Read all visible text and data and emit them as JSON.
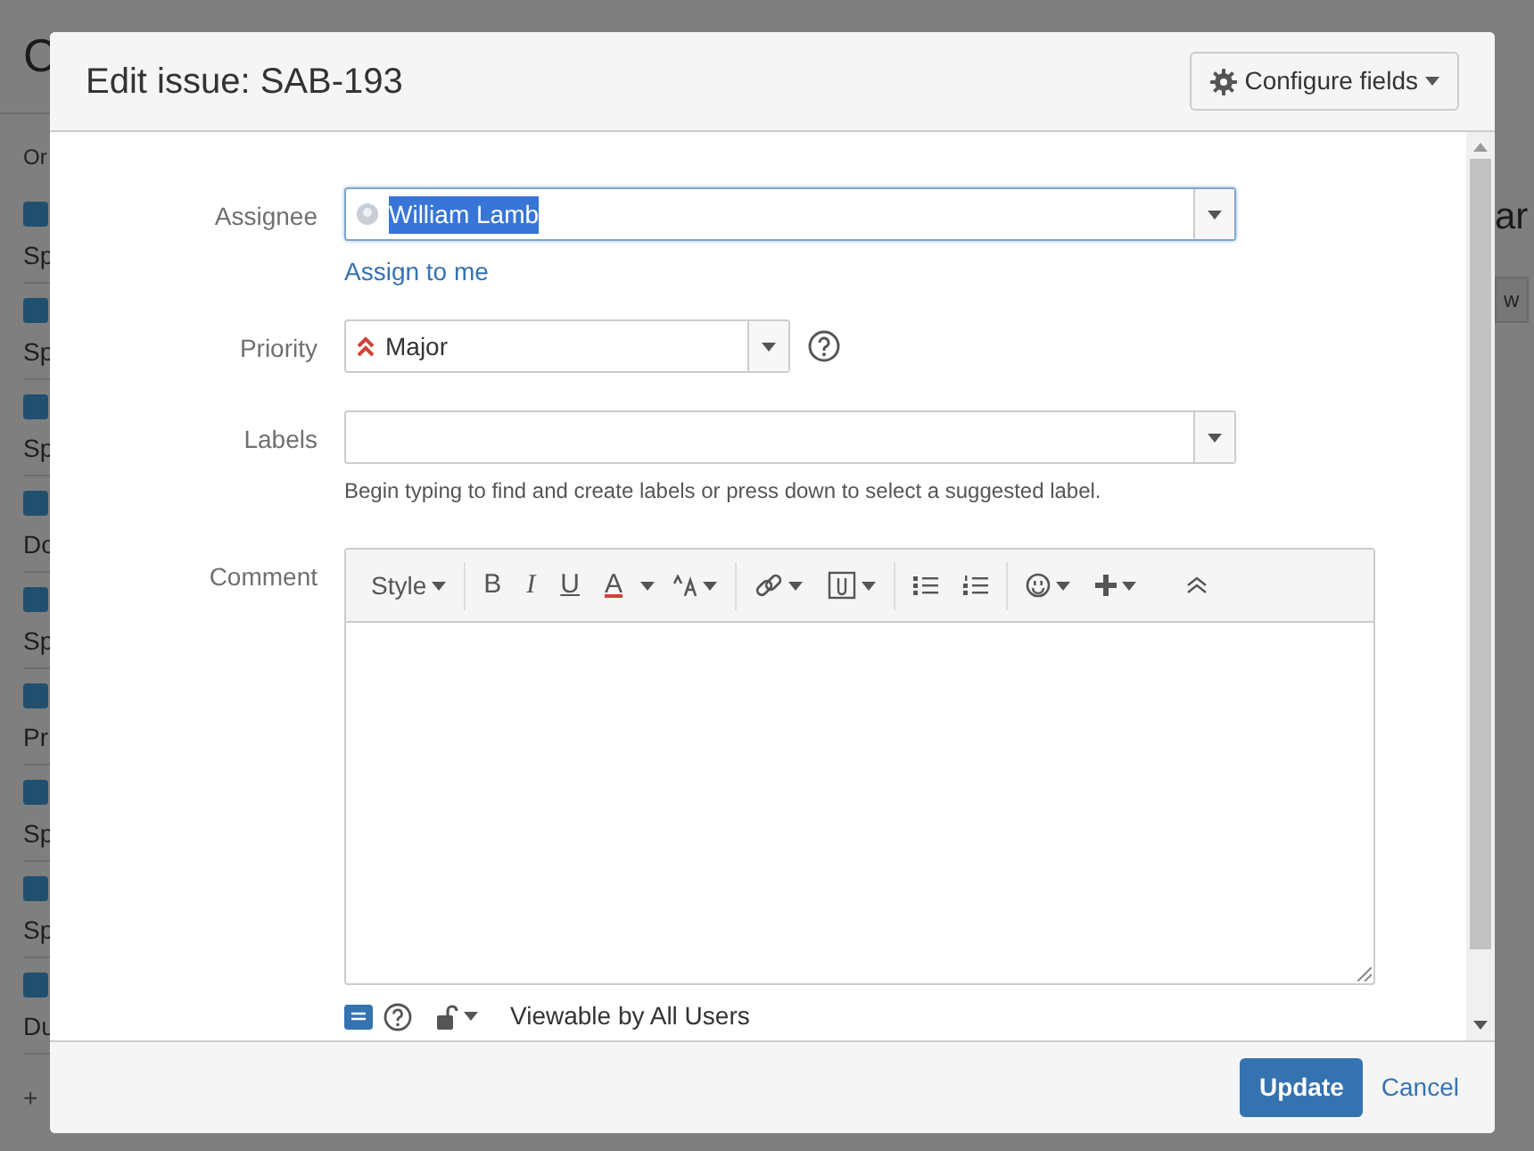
{
  "backdrop": {
    "page_title": "C",
    "sidebar_heading": "Or",
    "sidebar_items": [
      {
        "checked": true,
        "label": "Sp"
      },
      {
        "checked": true,
        "label": "Sp"
      },
      {
        "checked": true,
        "label": "Sp"
      },
      {
        "checked": true,
        "label": "Do"
      },
      {
        "checked": true,
        "label": "Sp"
      },
      {
        "checked": true,
        "label": "Pr"
      },
      {
        "checked": true,
        "label": "Sp"
      },
      {
        "checked": true,
        "label": "Sp"
      },
      {
        "checked": true,
        "label": "Du"
      }
    ],
    "add_label": "+",
    "right_title": "ar",
    "right_button": "w"
  },
  "dialog": {
    "title": "Edit issue: SAB-193",
    "configure_button": "Configure fields",
    "assignee": {
      "label": "Assignee",
      "value": "William Lamb",
      "highlighted": true,
      "focused": true,
      "link": "Assign to me"
    },
    "priority": {
      "label": "Priority",
      "value": "Major"
    },
    "labels": {
      "label": "Labels",
      "hint": "Begin typing to find and create labels or press down to select a suggested label."
    },
    "comment": {
      "label": "Comment",
      "toolbar": [
        {
          "kind": "dropdown",
          "label": "Style"
        },
        {
          "kind": "bold",
          "label": "B"
        },
        {
          "kind": "italic",
          "label": "I"
        },
        {
          "kind": "underline",
          "label": "U"
        },
        {
          "kind": "color",
          "label": "A"
        }
      ],
      "visibility": "Viewable by All Users"
    },
    "buttons": [
      {
        "kind": "primary",
        "label": "Update"
      },
      {
        "kind": "link",
        "label": "Cancel"
      }
    ]
  }
}
